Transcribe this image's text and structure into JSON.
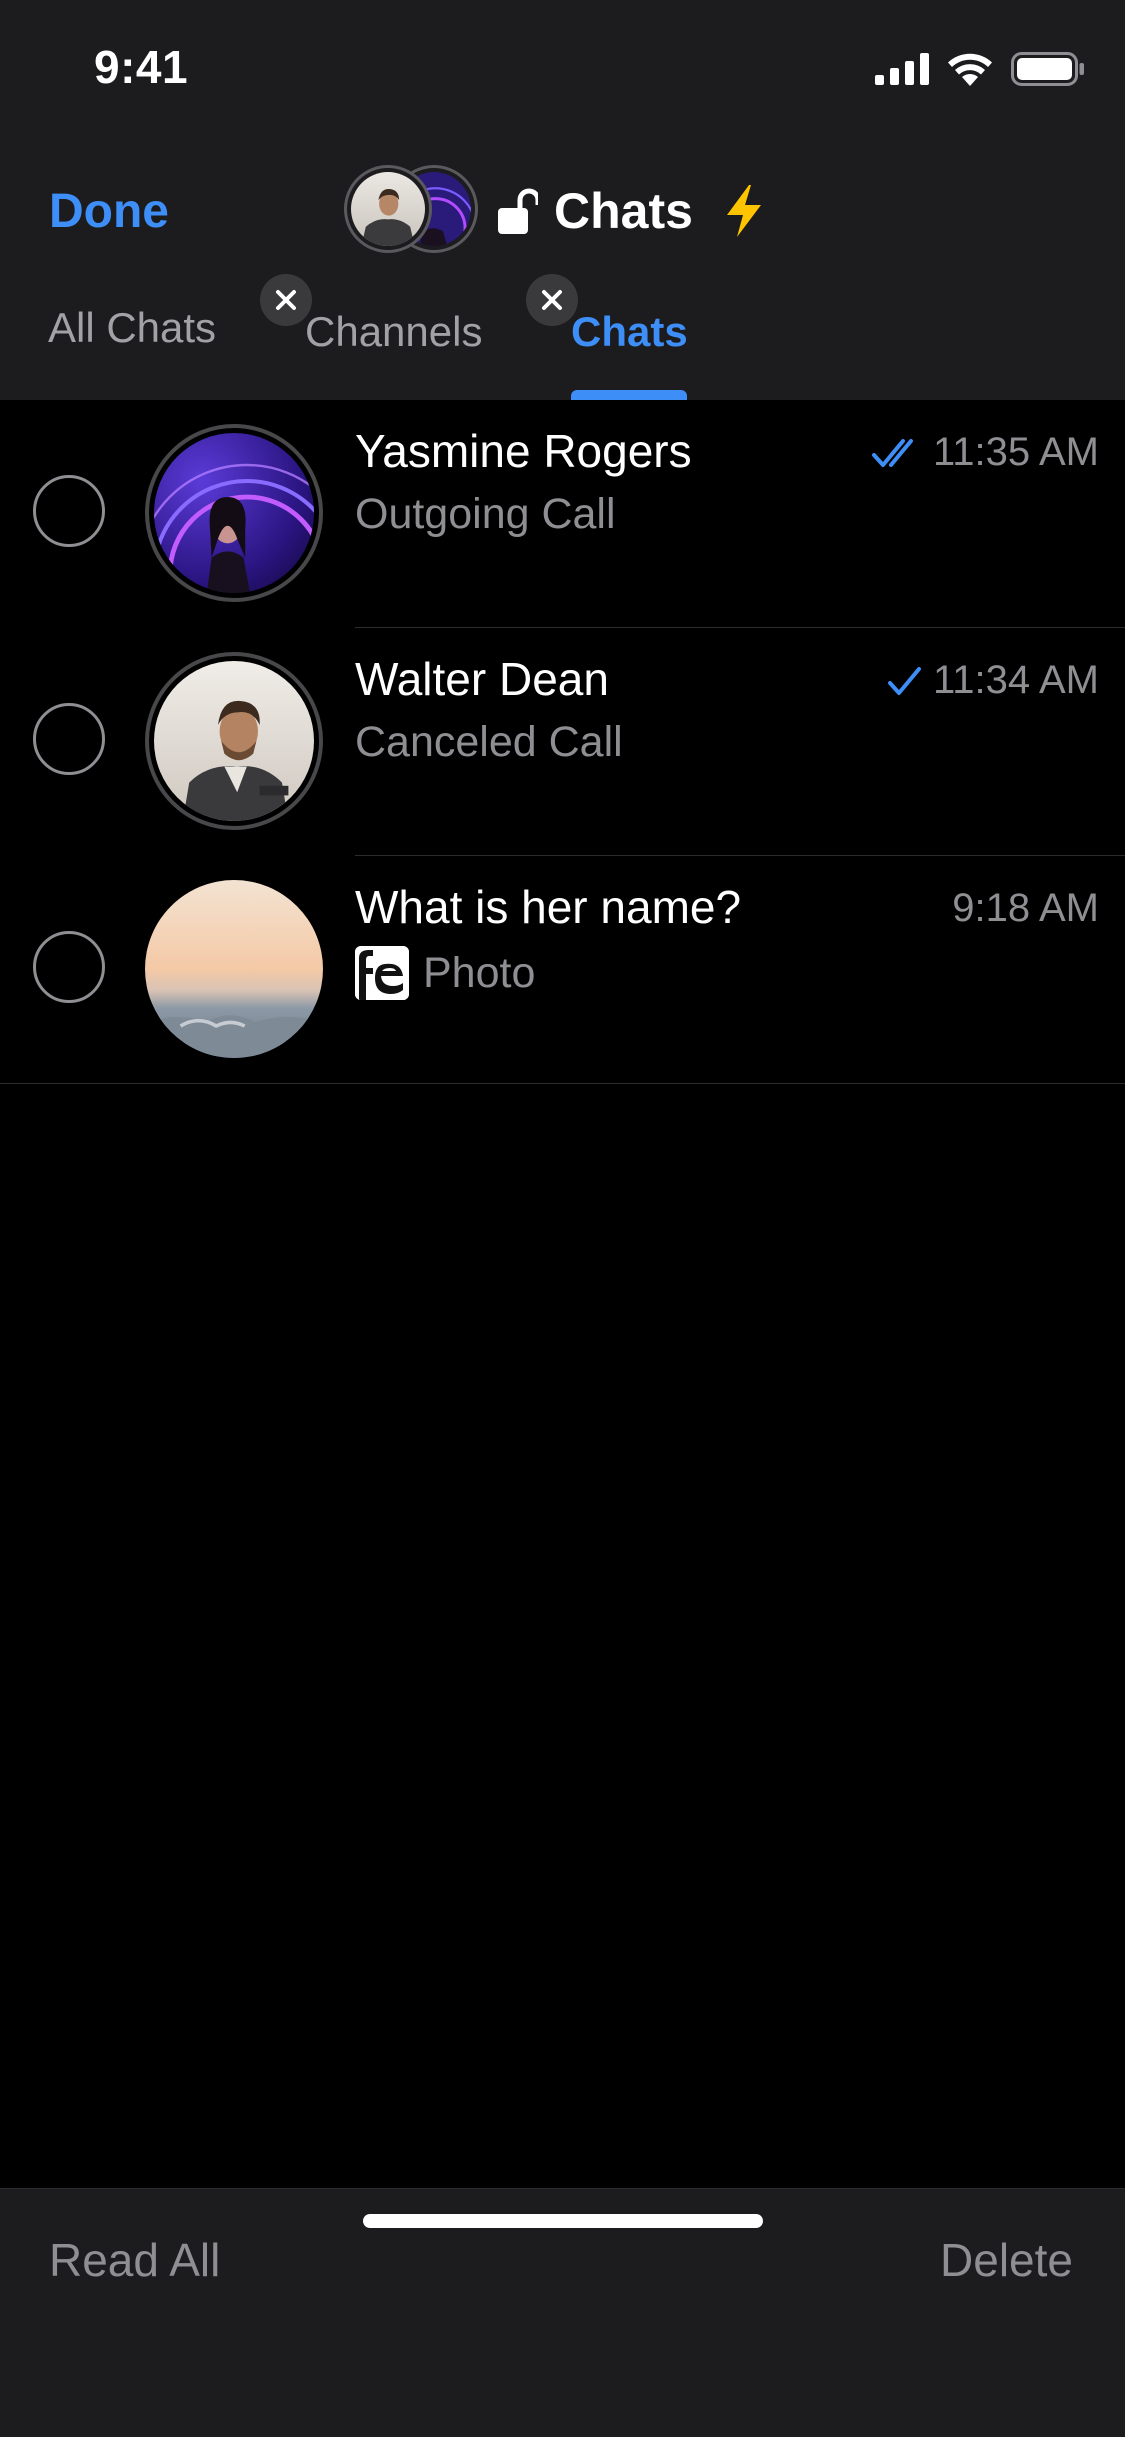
{
  "status_bar": {
    "time": "9:41"
  },
  "header": {
    "done_label": "Done",
    "title": "Chats",
    "lock_icon": "lock-open-icon",
    "bolt_icon": "lightning-bolt-icon"
  },
  "tabs": [
    {
      "label": "All Chats",
      "active": false,
      "removable": false
    },
    {
      "label": "Channels",
      "active": false,
      "removable": true
    },
    {
      "label": "Chats",
      "active": true,
      "removable": true
    }
  ],
  "chats": [
    {
      "name": "Yasmine Rogers",
      "preview": "Outgoing Call",
      "time": "11:35 AM",
      "status": "read-double-check",
      "has_story": true
    },
    {
      "name": "Walter Dean",
      "preview": "Canceled Call",
      "time": "11:34 AM",
      "status": "sent-single-check",
      "has_story": true
    },
    {
      "name": "What is her name?",
      "preview": "Photo",
      "time": "9:18 AM",
      "status": "none",
      "has_story": false
    }
  ],
  "toolbar": {
    "read_all_label": "Read All",
    "delete_label": "Delete"
  },
  "colors": {
    "accent": "#3e8ef7",
    "background": "#000000",
    "header_background": "#1c1c1e",
    "secondary_text": "#8e8e93",
    "bolt": "#ffc400"
  }
}
